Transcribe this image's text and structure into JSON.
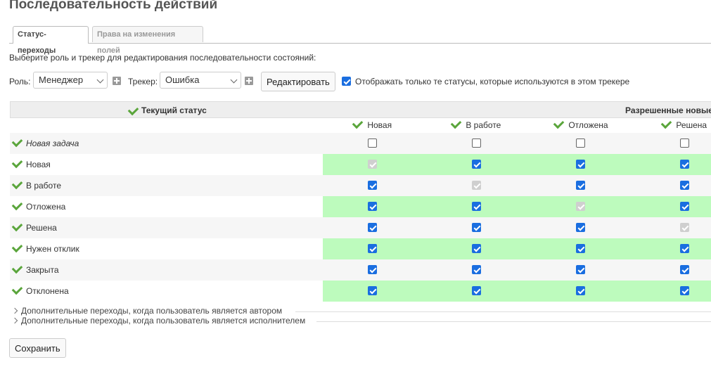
{
  "page": {
    "title": "Последовательность действий"
  },
  "tabs": [
    {
      "label": "Статус-переходы",
      "selected": true
    },
    {
      "label": "Права на изменения полей",
      "selected": false
    }
  ],
  "intro": "Выберите роль и трекер для редактирования последовательности состояний:",
  "filters": {
    "role_label": "Роль:",
    "role_value": "Менеджер",
    "tracker_label": "Трекер:",
    "tracker_value": "Ошибка",
    "edit_button": "Редактировать",
    "only_used_label": "Отображать только те статусы, которые используются в этом трекере",
    "only_used_checked": true
  },
  "grid": {
    "current_status_header": "Текущий статус",
    "allowed_header": "Разрешенные новые статусы",
    "columns": [
      "Новая",
      "В работе",
      "Отложена",
      "Решена"
    ],
    "rows": [
      {
        "label": "Новая задача",
        "italic": true,
        "cells": [
          "off",
          "off",
          "off",
          "off"
        ]
      },
      {
        "label": "Новая",
        "cells": [
          "dis",
          "on",
          "on",
          "on"
        ]
      },
      {
        "label": "В работе",
        "cells": [
          "on",
          "dis",
          "on",
          "on"
        ]
      },
      {
        "label": "Отложена",
        "cells": [
          "on",
          "on",
          "dis",
          "on"
        ]
      },
      {
        "label": "Решена",
        "cells": [
          "on",
          "on",
          "on",
          "dis"
        ]
      },
      {
        "label": "Нужен отклик",
        "cells": [
          "on",
          "on",
          "on",
          "on"
        ]
      },
      {
        "label": "Закрыта",
        "cells": [
          "on",
          "on",
          "on",
          "on"
        ]
      },
      {
        "label": "Отклонена",
        "cells": [
          "on",
          "on",
          "on",
          "on"
        ]
      }
    ]
  },
  "extra": [
    "Дополнительные переходы, когда пользователь является автором",
    "Дополнительные переходы, когда пользователь является исполнителем"
  ],
  "save_button": "Сохранить",
  "colors": {
    "accent": "#1a6ee0",
    "allowed_bg": "#bdfbbd",
    "tick": "#5aa53b"
  }
}
